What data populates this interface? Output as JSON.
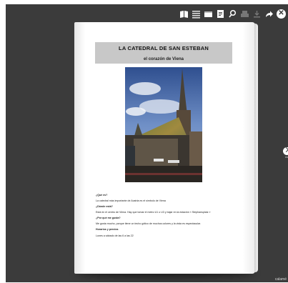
{
  "toolbar": {
    "icons": [
      "book-icon",
      "list-icon",
      "page-icon",
      "document-icon",
      "search-icon",
      "print-icon",
      "download-icon",
      "share-icon",
      "close-icon"
    ],
    "close_glyph": "✕"
  },
  "document": {
    "title": "LA CATEDRAL DE SAN ESTEBAN",
    "subtitle": "el corazón de Viena",
    "photo_alt": "Catedral de San Esteban",
    "qa": [
      {
        "q": "¿Qué es?",
        "a": "La catedral más importante de Austria es el símbolo de Viena"
      },
      {
        "q": "¿Dónde está?",
        "a": "Está en el centro de Viena. Hay que tomar el metro U1 o U3 y bajar en la estación « Stephansplatz »"
      },
      {
        "q": "¿Por qué me gusta?",
        "a": "Me gusta mucho, porque tiene un techo gótico de muchos colores y la vista es espectacular."
      },
      {
        "q": "Horarios y precios",
        "a": "Lunes a sábado de las 6 a las 22"
      }
    ]
  },
  "nav": {
    "next_glyph": "›",
    "next_sub": "ea"
  },
  "brand": "calamé"
}
